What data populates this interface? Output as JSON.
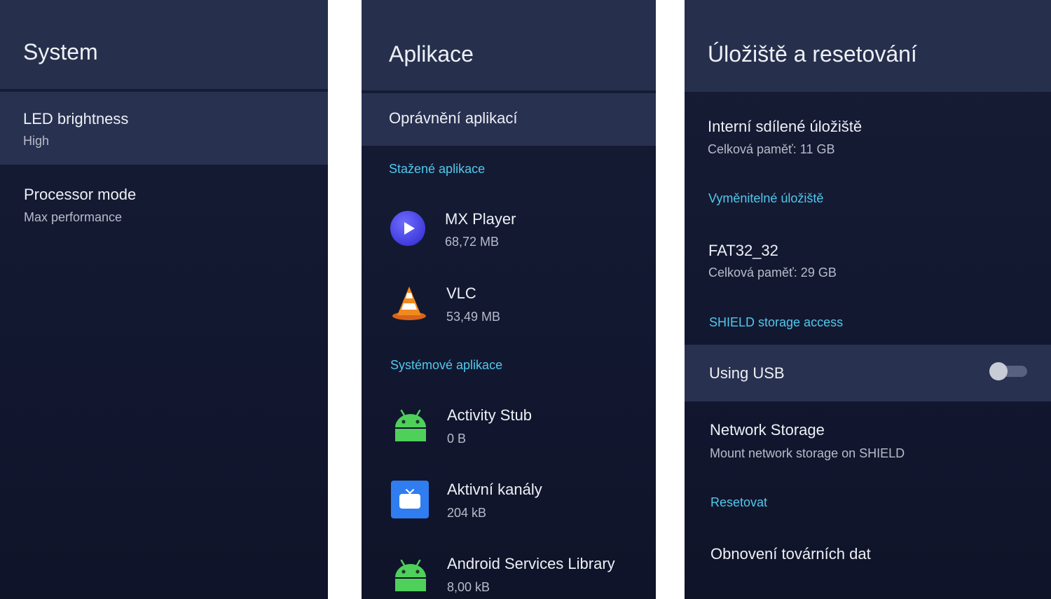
{
  "panel_system": {
    "title": "System",
    "items": [
      {
        "title": "LED brightness",
        "subtitle": "High"
      },
      {
        "title": "Processor mode",
        "subtitle": "Max performance"
      }
    ]
  },
  "panel_apps": {
    "title": "Aplikace",
    "permissions_item": "Oprávnění aplikací",
    "downloaded_header": "Stažené aplikace",
    "downloaded_apps": [
      {
        "name": "MX Player",
        "size": "68,72 MB",
        "icon": "mx-player-icon"
      },
      {
        "name": "VLC",
        "size": "53,49 MB",
        "icon": "vlc-cone-icon"
      }
    ],
    "system_header": "Systémové aplikace",
    "system_apps": [
      {
        "name": "Activity Stub",
        "size": "0 B",
        "icon": "android-robot-icon"
      },
      {
        "name": "Aktivní kanály",
        "size": "204 kB",
        "icon": "tv-channels-icon"
      },
      {
        "name": "Android Services Library",
        "size": "8,00 kB",
        "icon": "android-robot-icon"
      }
    ]
  },
  "panel_storage": {
    "title": "Úložiště a resetování",
    "internal": {
      "title": "Interní sdílené úložiště",
      "subtitle": "Celková paměť: 11 GB"
    },
    "removable_header": "Vyměnitelné úložiště",
    "fat32": {
      "title": "FAT32_32",
      "subtitle": "Celková paměť: 29 GB"
    },
    "shield_header": "SHIELD storage access",
    "using_usb": {
      "title": "Using USB",
      "toggle_on": false
    },
    "network_storage": {
      "title": "Network Storage",
      "subtitle": "Mount network storage on SHIELD"
    },
    "reset_header": "Resetovat",
    "factory_reset": {
      "title": "Obnovení továrních dat"
    }
  },
  "colors": {
    "background": "#121730",
    "header": "#26304d",
    "selected_row": "#283150",
    "section_accent": "#52c8ec",
    "text_primary": "#eef0f5",
    "text_secondary": "#b7bcca"
  }
}
